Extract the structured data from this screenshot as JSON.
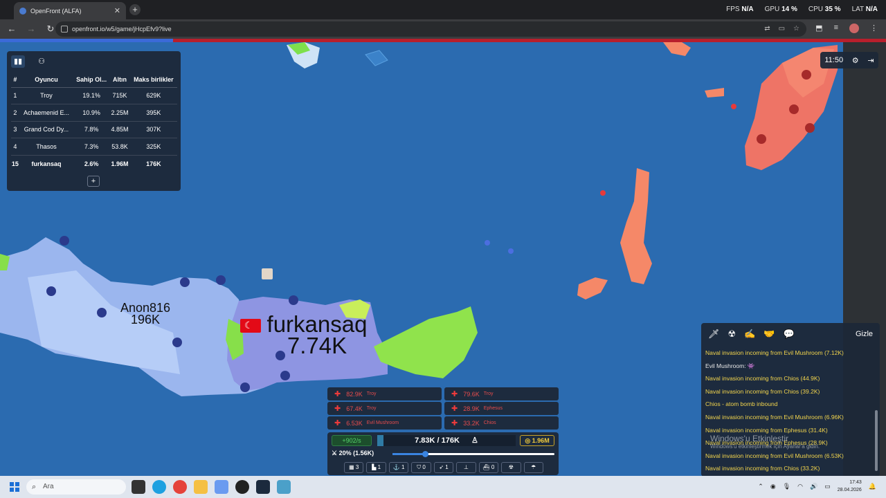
{
  "browser": {
    "tab_title": "OpenFront (ALFA)",
    "url": "openfront.io/w5/game/jHcpEfv9?live",
    "perf": [
      {
        "label": "FPS",
        "value": "N/A"
      },
      {
        "label": "GPU",
        "value": "14 %"
      },
      {
        "label": "CPU",
        "value": "35 %"
      },
      {
        "label": "LAT",
        "value": "N/A"
      }
    ]
  },
  "leaderboard": {
    "headers": [
      "#",
      "Oyuncu",
      "Sahip Ol...",
      "Altın",
      "Maks birlikler"
    ],
    "rows": [
      {
        "rank": "1",
        "player": "Troy",
        "owned": "19.1%",
        "gold": "715K",
        "max_troops": "629K"
      },
      {
        "rank": "2",
        "player": "Achaemenid E...",
        "owned": "10.9%",
        "gold": "2.25M",
        "max_troops": "395K"
      },
      {
        "rank": "3",
        "player": "Grand Cod Dy...",
        "owned": "7.8%",
        "gold": "4.85M",
        "max_troops": "307K"
      },
      {
        "rank": "4",
        "player": "Thasos",
        "owned": "7.3%",
        "gold": "53.8K",
        "max_troops": "325K"
      },
      {
        "rank": "15",
        "player": "furkansaq",
        "owned": "2.6%",
        "gold": "1.96M",
        "max_troops": "176K"
      }
    ],
    "expand_label": "+"
  },
  "timer": "11:50",
  "map_labels": {
    "anon_name": "Anon816",
    "anon_troops": "196K",
    "player_name": "furkansaq",
    "player_troops": "7.74K"
  },
  "attacks": [
    {
      "amount": "82.9K",
      "name": "Troy"
    },
    {
      "amount": "79.6K",
      "name": "Troy"
    },
    {
      "amount": "67.4K",
      "name": "Troy"
    },
    {
      "amount": "28.9K",
      "name": "Ephesus"
    },
    {
      "amount": "6.53K",
      "name": "Evil Mushroom"
    },
    {
      "amount": "33.2K",
      "name": "Chios"
    }
  ],
  "controls": {
    "income": "+902/s",
    "troops": "7.83K / 176K",
    "troops_fraction": 0.044,
    "gold": "1.96M",
    "attack_ratio": "20% (1.56K)",
    "attack_ratio_value": 0.2,
    "buildings": [
      "3",
      "1",
      "1",
      "0",
      "1",
      "",
      "0",
      "",
      ""
    ]
  },
  "events": {
    "hide_label": "Gizle",
    "items": [
      {
        "text": "Naval invasion incoming from Evil Mushroom (7.12K)",
        "color": "yellow"
      },
      {
        "text": "Evil Mushroom: 👾",
        "color": "white"
      },
      {
        "text": "Naval invasion incoming from Chios (44.9K)",
        "color": "yellow"
      },
      {
        "text": "Naval invasion incoming from Chios (39.2K)",
        "color": "yellow"
      },
      {
        "text": "Chios - atom bomb inbound",
        "color": "yellow"
      },
      {
        "text": "Naval invasion incoming from Evil Mushroom (6.96K)",
        "color": "yellow"
      },
      {
        "text": "Naval invasion incoming from Ephesus (31.4K)",
        "color": "yellow"
      },
      {
        "text": "Naval invasion incoming from Ephesus (28.9K)",
        "color": "yellow"
      },
      {
        "text": "Naval invasion incoming from Evil Mushroom (6.53K)",
        "color": "yellow"
      },
      {
        "text": "Naval invasion incoming from Chios (33.2K)",
        "color": "yellow"
      }
    ]
  },
  "watermark": {
    "title": "Windows'u Etkinleştir",
    "subtitle": "Windows'u etkinleştirmek için Ayarlar'a gidin."
  },
  "taskbar": {
    "search_placeholder": "Ara",
    "time": "17:43",
    "date": "28.04.2026"
  }
}
